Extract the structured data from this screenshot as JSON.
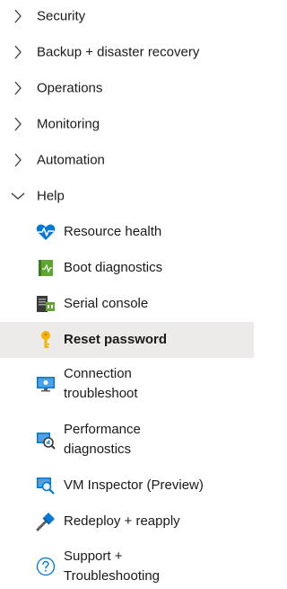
{
  "groups": [
    {
      "label": "Security",
      "expanded": false,
      "icon": "chevron-right-icon"
    },
    {
      "label": "Backup + disaster recovery",
      "expanded": false,
      "icon": "chevron-right-icon"
    },
    {
      "label": "Operations",
      "expanded": false,
      "icon": "chevron-right-icon"
    },
    {
      "label": "Monitoring",
      "expanded": false,
      "icon": "chevron-right-icon"
    },
    {
      "label": "Automation",
      "expanded": false,
      "icon": "chevron-right-icon"
    },
    {
      "label": "Help",
      "expanded": true,
      "icon": "chevron-down-icon"
    }
  ],
  "help_items": [
    {
      "label": "Resource health",
      "icon": "heart-pulse-icon"
    },
    {
      "label": "Boot diagnostics",
      "icon": "boot-diagnostics-icon"
    },
    {
      "label": "Serial console",
      "icon": "serial-console-icon"
    },
    {
      "label": "Reset password",
      "icon": "key-icon",
      "selected": true
    },
    {
      "label_line1": "Connection",
      "label_line2": "troubleshoot",
      "icon": "monitor-icon"
    },
    {
      "label_line1": "Performance",
      "label_line2": "diagnostics",
      "icon": "performance-diagnostics-icon"
    },
    {
      "label": "VM Inspector (Preview)",
      "icon": "vm-inspector-icon"
    },
    {
      "label": "Redeploy + reapply",
      "icon": "hammer-icon"
    },
    {
      "label_line1": "Support +",
      "label_line2": "Troubleshooting",
      "icon": "question-circle-icon"
    }
  ],
  "colors": {
    "text": "#1b1a19",
    "selected_bg": "#edebe9",
    "accent_blue": "#0078d4",
    "key_yellow": "#f5b301",
    "boot_green": "#5ea72f"
  }
}
